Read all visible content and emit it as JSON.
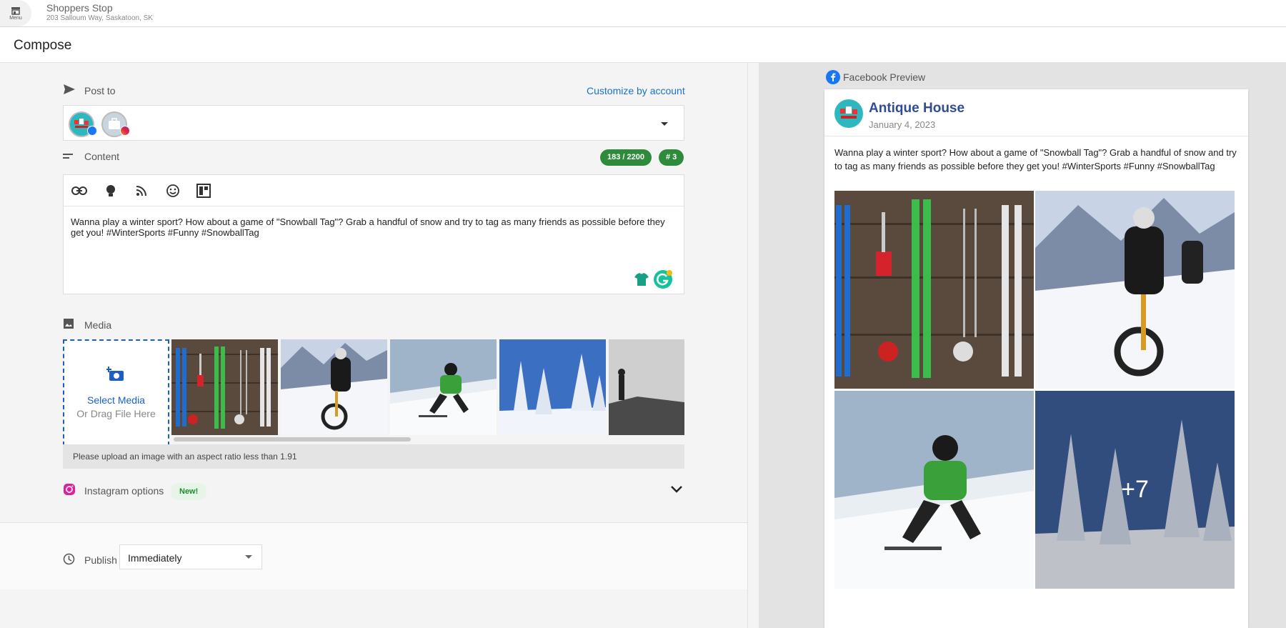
{
  "topbar": {
    "menu_label": "Menu",
    "store_name": "Shoppers Stop",
    "store_address": "203 Salloum Way, Saskatoon, SK"
  },
  "compose": {
    "title": "Compose"
  },
  "post_to": {
    "label": "Post to",
    "customize_link": "Customize by account",
    "accounts": [
      {
        "network": "facebook",
        "icon": "facebook-icon"
      },
      {
        "network": "instagram",
        "icon": "instagram-icon"
      }
    ]
  },
  "content": {
    "label": "Content",
    "char_count": "183 / 2200",
    "hashtag_count": "# 3",
    "toolbar": [
      "link-icon",
      "lightbulb-icon",
      "rss-feed-icon",
      "emoji-icon",
      "template-icon"
    ],
    "text": "Wanna play a winter sport? How about a game of \"Snowball Tag\"? Grab a handful of snow and try to tag as many friends as possible before they get you! #WinterSports #Funny #SnowballTag"
  },
  "media": {
    "label": "Media",
    "select_label": "Select Media",
    "drag_label": "Or Drag File Here",
    "warning": "Please upload an image with an aspect ratio less than 1.91"
  },
  "instagram_options": {
    "label": "Instagram options",
    "badge": "New!"
  },
  "publish": {
    "label": "Publish",
    "selected": "Immediately"
  },
  "preview": {
    "label": "Facebook Preview",
    "account_name": "Antique House",
    "date": "January 4, 2023",
    "text": "Wanna play a winter sport? How about a game of \"Snowball Tag\"? Grab a handful of snow and try to tag as many friends as possible before they get you! #WinterSports #Funny #SnowballTag",
    "more_count": "+7"
  },
  "colors": {
    "accent_blue": "#1a73c8",
    "count_green": "#2e8b3c",
    "fb_name": "#2f4c95"
  }
}
